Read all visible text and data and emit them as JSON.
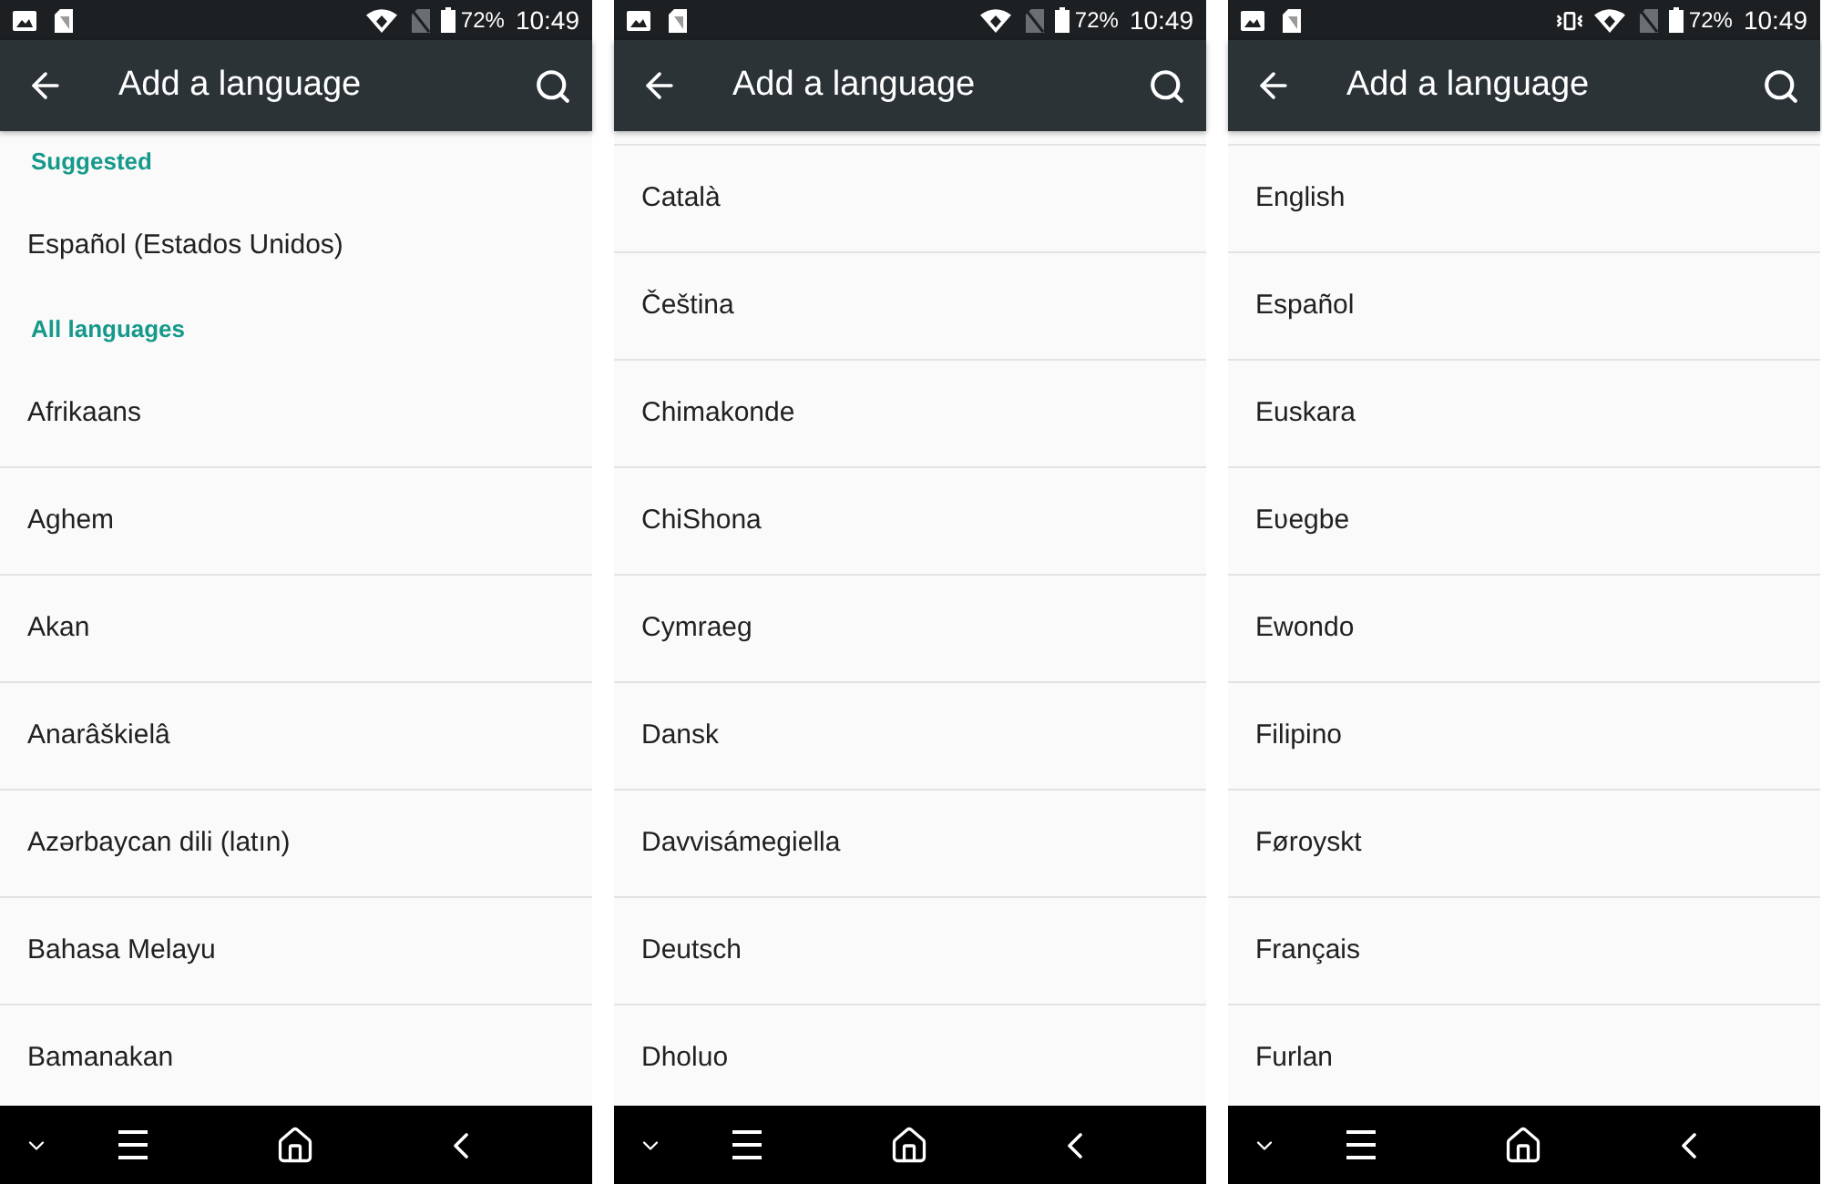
{
  "screens": [
    {
      "status_bar": {
        "vibrate": false,
        "battery": "72%",
        "time": "10:49"
      },
      "app_bar": {
        "title": "Add a language"
      },
      "list": {
        "scrolled": false,
        "sections": [
          {
            "title": "Suggested",
            "items": [
              {
                "label": "Español (Estados Unidos)"
              }
            ]
          },
          {
            "title": "All languages",
            "items": [
              {
                "label": "Afrikaans"
              },
              {
                "label": "Aghem"
              },
              {
                "label": "Akan"
              },
              {
                "label": "Anarâškielâ"
              },
              {
                "label": "Azərbaycan dili (latın)"
              },
              {
                "label": "Bahasa Melayu"
              },
              {
                "label": "Bamanakan"
              }
            ]
          }
        ]
      }
    },
    {
      "status_bar": {
        "vibrate": false,
        "battery": "72%",
        "time": "10:49"
      },
      "app_bar": {
        "title": "Add a language"
      },
      "list": {
        "scrolled": true,
        "sections": [
          {
            "items": [
              {
                "label": "Català"
              },
              {
                "label": "Čeština"
              },
              {
                "label": "Chimakonde"
              },
              {
                "label": "ChiShona"
              },
              {
                "label": "Cymraeg"
              },
              {
                "label": "Dansk"
              },
              {
                "label": "Davvisámegiella"
              },
              {
                "label": "Deutsch"
              },
              {
                "label": "Dholuo"
              }
            ]
          }
        ]
      }
    },
    {
      "status_bar": {
        "vibrate": true,
        "battery": "72%",
        "time": "10:49"
      },
      "app_bar": {
        "title": "Add a language"
      },
      "list": {
        "scrolled": true,
        "sections": [
          {
            "items": [
              {
                "label": "English"
              },
              {
                "label": "Español"
              },
              {
                "label": "Euskara"
              },
              {
                "label": "Eʋegbe"
              },
              {
                "label": "Ewondo"
              },
              {
                "label": "Filipino"
              },
              {
                "label": "Føroyskt"
              },
              {
                "label": "Français"
              },
              {
                "label": "Furlan"
              }
            ]
          }
        ]
      }
    }
  ]
}
